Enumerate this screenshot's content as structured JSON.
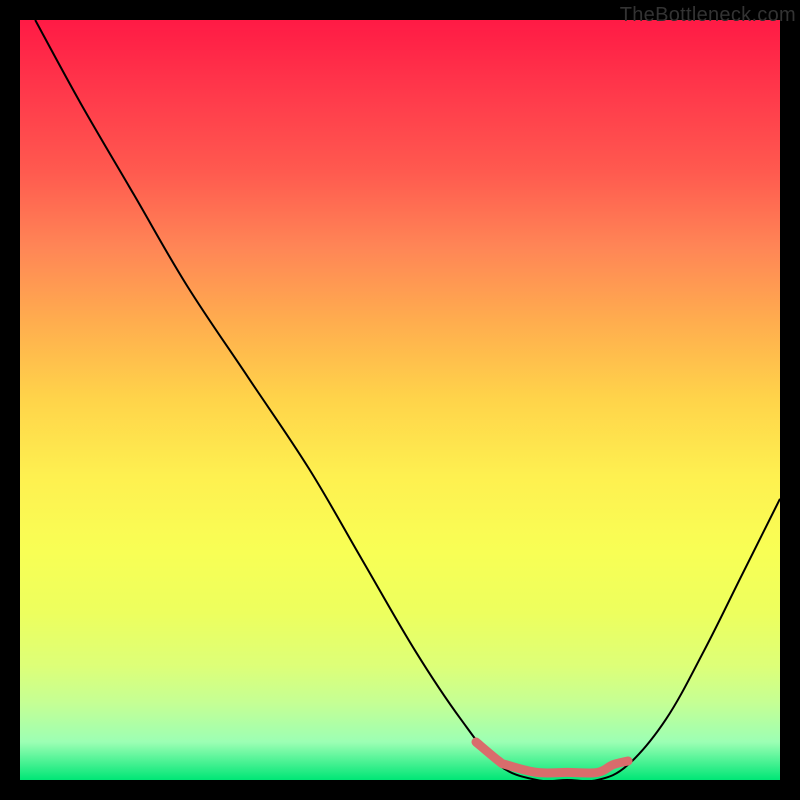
{
  "watermark": "TheBottleneck.com",
  "colors": {
    "background": "#000000",
    "curve": "#000000",
    "highlight": "#d96c6c",
    "gradient_top": "#ff1a45",
    "gradient_bottom": "#00e676"
  },
  "chart_data": {
    "type": "line",
    "title": "",
    "xlabel": "",
    "ylabel": "",
    "xlim": [
      0,
      100
    ],
    "ylim": [
      0,
      100
    ],
    "curve": {
      "name": "bottleneck-curve",
      "points": [
        {
          "x": 2,
          "y": 100
        },
        {
          "x": 8,
          "y": 89
        },
        {
          "x": 15,
          "y": 77
        },
        {
          "x": 22,
          "y": 65
        },
        {
          "x": 30,
          "y": 53
        },
        {
          "x": 38,
          "y": 41
        },
        {
          "x": 45,
          "y": 29
        },
        {
          "x": 52,
          "y": 17
        },
        {
          "x": 58,
          "y": 8
        },
        {
          "x": 63,
          "y": 2
        },
        {
          "x": 68,
          "y": 0
        },
        {
          "x": 72,
          "y": 0
        },
        {
          "x": 76,
          "y": 0
        },
        {
          "x": 80,
          "y": 2
        },
        {
          "x": 85,
          "y": 8
        },
        {
          "x": 90,
          "y": 17
        },
        {
          "x": 95,
          "y": 27
        },
        {
          "x": 100,
          "y": 37
        }
      ]
    },
    "highlight": {
      "name": "optimal-zone",
      "points": [
        {
          "x": 60,
          "y": 5
        },
        {
          "x": 63,
          "y": 2.5
        },
        {
          "x": 64,
          "y": 2
        },
        {
          "x": 68,
          "y": 1
        },
        {
          "x": 72,
          "y": 1
        },
        {
          "x": 76,
          "y": 1
        },
        {
          "x": 78,
          "y": 2
        },
        {
          "x": 80,
          "y": 2.5
        }
      ]
    }
  }
}
